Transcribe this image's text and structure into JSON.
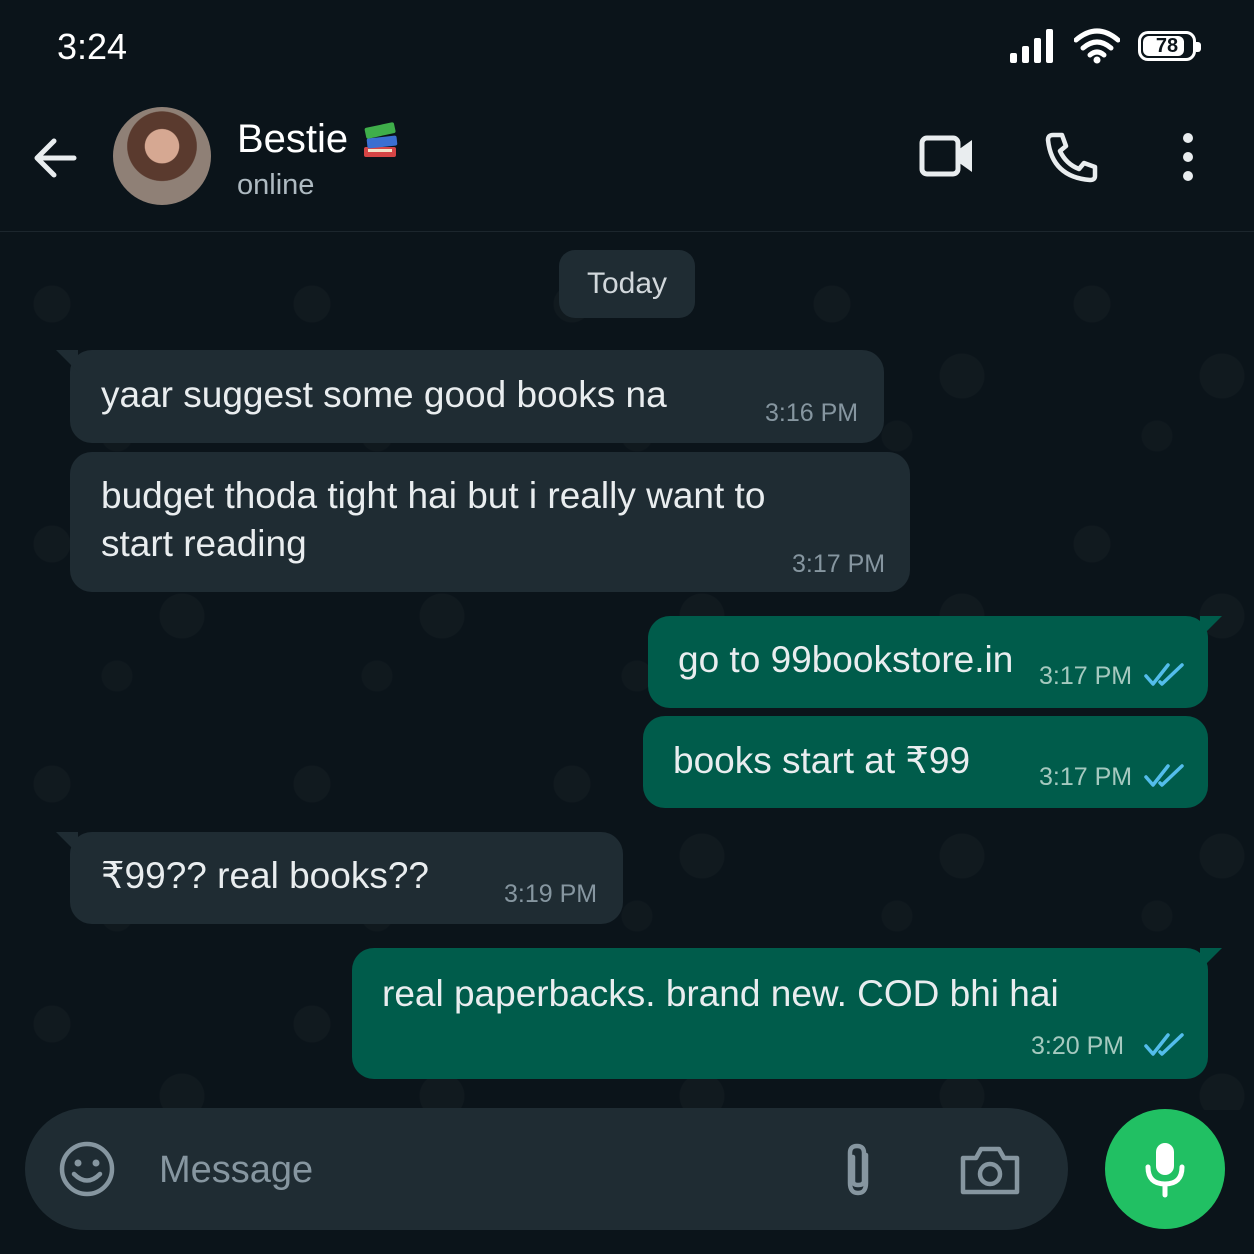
{
  "status_bar": {
    "time": "3:24",
    "battery": "78"
  },
  "header": {
    "name": "Bestie",
    "name_emoji": "books-emoji",
    "status": "online",
    "icons": [
      "back-arrow-icon",
      "video-call-icon",
      "phone-icon",
      "more-vert-icon"
    ]
  },
  "chat": {
    "day_label": "Today",
    "messages": [
      {
        "direction": "incoming",
        "text": "yaar suggest some good books na",
        "time": "3:16 PM"
      },
      {
        "direction": "incoming",
        "text": "budget thoda tight hai but i really want to\nstart reading",
        "time": "3:17 PM"
      },
      {
        "direction": "outgoing",
        "text": "go to 99bookstore.in",
        "time": "3:17 PM",
        "read": true
      },
      {
        "direction": "outgoing",
        "text": "books start at ₹99",
        "time": "3:17 PM",
        "read": true
      },
      {
        "direction": "incoming",
        "text": "₹99?? real books??",
        "time": "3:19 PM"
      },
      {
        "direction": "outgoing",
        "text": "real paperbacks. brand new. COD bhi hai",
        "time": "3:20 PM",
        "read": true
      }
    ]
  },
  "composer": {
    "placeholder": "Message",
    "icons": [
      "emoji-icon",
      "attach-icon",
      "camera-icon",
      "mic-icon"
    ]
  },
  "colors": {
    "incoming_bubble": "#1f2c33",
    "outgoing_bubble": "#005c4b",
    "accent": "#21c063",
    "read_ticks": "#53bdeb"
  }
}
